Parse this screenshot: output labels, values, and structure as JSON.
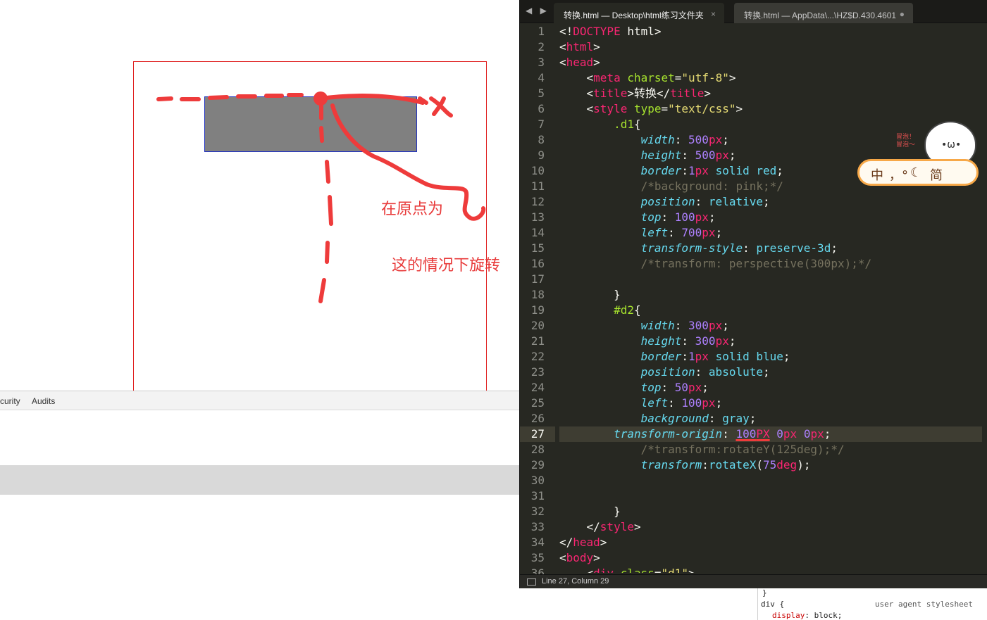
{
  "preview": {
    "annotation_1": "在原点为",
    "annotation_2": "这的情况下旋转"
  },
  "devtools": {
    "tab_security": "curity",
    "tab_audits": "Audits",
    "styles": {
      "close_brace": "}",
      "selector": "div {",
      "origin": "user agent stylesheet",
      "declaration_prop": "display",
      "declaration_value": ": block;"
    }
  },
  "editor": {
    "nav_arrows": "◀ ▶",
    "tabs": [
      {
        "label": "转换.html — Desktop\\html练习文件夹",
        "control": "×"
      },
      {
        "label": "转换.html — AppData\\...\\HZ$D.430.4601",
        "control": "●"
      }
    ],
    "current_line": 27,
    "status": "Line 27, Column 29"
  },
  "ime": {
    "mode": "中",
    "punct": "，°",
    "moon": "☾",
    "simplified": "简",
    "bubble_text": "冒泡！\n冒泡～"
  },
  "colors": {
    "editor_bg": "#272822",
    "annotation_red": "#e83a3a",
    "d1_border": "#e02020",
    "d2_fill": "#808080",
    "d2_border": "#2030c0"
  }
}
